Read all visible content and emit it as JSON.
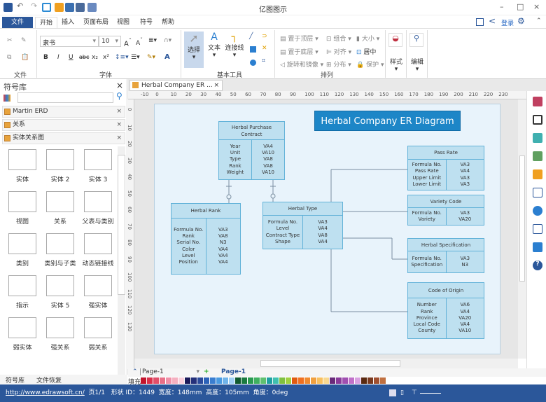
{
  "app": {
    "title": "亿图图示"
  },
  "quick_access": [
    "app-icon",
    "undo-icon",
    "redo-icon",
    "new-icon",
    "open-icon",
    "save-icon",
    "print-icon",
    "export-icon"
  ],
  "menu": {
    "file": "文件",
    "tabs": [
      "开始",
      "插入",
      "页面布局",
      "视图",
      "符号",
      "帮助"
    ],
    "login": "登录"
  },
  "ribbon": {
    "font_name": "隶书",
    "font_size": "10",
    "groups": [
      "文件",
      "字体",
      "基本工具",
      "排列"
    ],
    "tools": [
      "选择",
      "文本",
      "连接线"
    ],
    "arrange": [
      "置于顶层",
      "组合",
      "大小",
      "置于底层",
      "对齐",
      "居中",
      "旋转和镜像",
      "分布",
      "保护"
    ],
    "style": "样式",
    "edit": "编辑",
    "format_buttons": [
      "B",
      "I",
      "U",
      "abc",
      "x₂",
      "x²",
      "A"
    ]
  },
  "library": {
    "title": "符号库",
    "sections": [
      "Martin ERD",
      "关系",
      "实体关系图"
    ],
    "shapes": [
      "实体",
      "实体 2",
      "实体 3",
      "视图",
      "关系",
      "父表与类别",
      "类别",
      "类别与子类",
      "动态链接线",
      "指示",
      "实体 5",
      "强实体",
      "弱实体",
      "强关系",
      "弱关系"
    ],
    "tabs": [
      "符号库",
      "文件恢复"
    ]
  },
  "document": {
    "tab": "Herbal Company ER ...",
    "page_selector": "Page-1",
    "page_tab": "Page-1",
    "fill_label": "填充"
  },
  "ruler": {
    "h": [
      "-10",
      "0",
      "10",
      "20",
      "30",
      "40",
      "50",
      "60",
      "70",
      "80",
      "90",
      "100",
      "110",
      "120",
      "130",
      "140",
      "150",
      "160",
      "170",
      "180",
      "190",
      "200",
      "210",
      "220",
      "230"
    ],
    "v": [
      "0",
      "10",
      "20",
      "30",
      "40",
      "50",
      "60",
      "70",
      "80",
      "90",
      "100",
      "110",
      "120",
      "130"
    ]
  },
  "diagram": {
    "title": "Herbal Company ER Diagram",
    "entities": [
      {
        "name": "Herbal Purchase Contract",
        "fields": [
          "Year",
          "Unit",
          "Type",
          "Rank",
          "Weight"
        ],
        "types": [
          "VA4",
          "VA10",
          "VA8",
          "VA8",
          "VA10"
        ]
      },
      {
        "name": "Herbal Rank",
        "fields": [
          "Formula No.",
          "Rank",
          "Serial No.",
          "Color",
          "Level",
          "Position"
        ],
        "types": [
          "VA3",
          "VA8",
          "N3",
          "VA4",
          "VA4",
          "VA4"
        ]
      },
      {
        "name": "Herbal Type",
        "fields": [
          "Formula No.",
          "Level",
          "Contract Type",
          "Shape"
        ],
        "types": [
          "VA3",
          "VA4",
          "VA8",
          "VA4"
        ]
      },
      {
        "name": "Pass Rate",
        "fields": [
          "Formula No.",
          "Pass Rate",
          "Upper Limit",
          "Lower Limit"
        ],
        "types": [
          "VA3",
          "VA4",
          "VA3",
          "VA3"
        ]
      },
      {
        "name": "Variety Code",
        "fields": [
          "Formula No.",
          "Variety"
        ],
        "types": [
          "VA3",
          "VA20"
        ]
      },
      {
        "name": "Herbal Specification",
        "fields": [
          "Formula No.",
          "Specification"
        ],
        "types": [
          "VA3",
          "N3"
        ]
      },
      {
        "name": "Code of Origin",
        "fields": [
          "Number",
          "Rank",
          "Province",
          "Local Code",
          "County"
        ],
        "types": [
          "VA6",
          "VA4",
          "VA20",
          "VA4",
          "VA10"
        ]
      }
    ],
    "colors": {
      "entity_fill": "#bee0f0",
      "entity_border": "#62b2d8",
      "title_fill": "#1d86c7"
    }
  },
  "status": {
    "url": "http://www.edrawsoft.cn/",
    "page": "页1/1",
    "shape_id": "形状 ID：1449",
    "width": "宽度：148mm",
    "height": "高度：105mm",
    "angle": "角度：0deg"
  },
  "colors": {
    "accent": "#2b579a"
  }
}
